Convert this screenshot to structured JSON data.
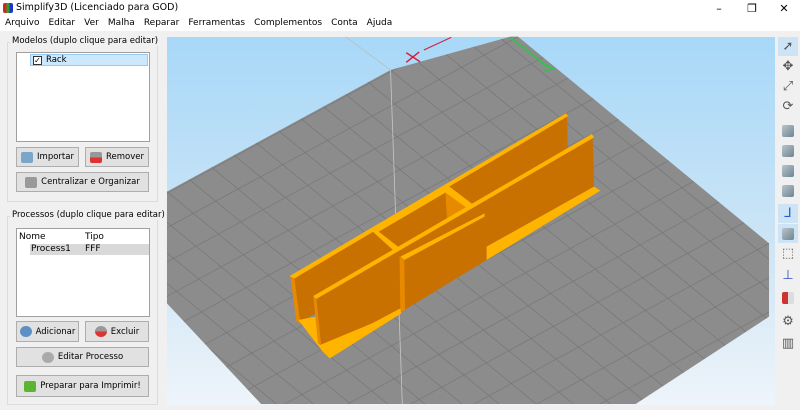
{
  "window": {
    "title": "Simplify3D (Licenciado para GOD)",
    "minimize": "–",
    "restore": "❐",
    "close": "✕"
  },
  "menu": [
    "Arquivo",
    "Editar",
    "Ver",
    "Malha",
    "Reparar",
    "Ferramentas",
    "Complementos",
    "Conta",
    "Ajuda"
  ],
  "models": {
    "label": "Modelos (duplo clique para editar)",
    "items": [
      {
        "name": "Rack",
        "checked": true
      }
    ],
    "import": "Importar",
    "remove": "Remover",
    "center": "Centralizar e Organizar"
  },
  "processes": {
    "label": "Processos (duplo clique para editar)",
    "columns": [
      "Nome",
      "Tipo"
    ],
    "rows": [
      {
        "name": "Process1",
        "type": "FFF"
      }
    ],
    "add": "Adicionar",
    "delete": "Excluir",
    "edit": "Editar Processo",
    "prepare": "Preparar para Imprimir!"
  },
  "toolbar": [
    "select-icon",
    "move-icon",
    "scale-icon",
    "rotate-icon",
    "view-iso-icon",
    "view-front-icon",
    "view-top-icon",
    "view-side-icon",
    "axes-icon",
    "solid-view-icon",
    "wireframe-icon",
    "normals-icon",
    "cross-section-icon",
    "settings-icon",
    "supports-icon"
  ],
  "colors": {
    "model_top": "#ffb400",
    "model_face": "#c87000",
    "plate": "#8c8c8c",
    "accent": "#cde4f7"
  }
}
